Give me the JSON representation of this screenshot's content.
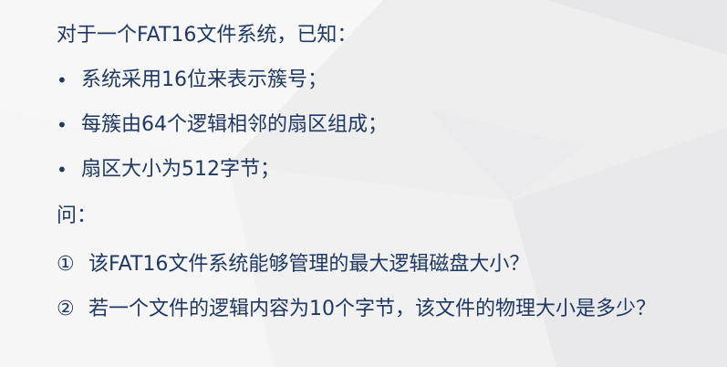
{
  "intro": "对于一个FAT16文件系统，已知：",
  "bullets": [
    {
      "marker": "•",
      "text": "系统采用16位来表示簇号；"
    },
    {
      "marker": "•",
      "text": "每簇由64个逻辑相邻的扇区组成；"
    },
    {
      "marker": "•",
      "text": "扇区大小为512字节；"
    }
  ],
  "question_label": "问：",
  "questions": [
    {
      "marker": "①",
      "text": "该FAT16文件系统能够管理的最大逻辑磁盘大小？"
    },
    {
      "marker": "②",
      "text": "若一个文件的逻辑内容为10个字节，该文件的物理大小是多少？"
    }
  ]
}
